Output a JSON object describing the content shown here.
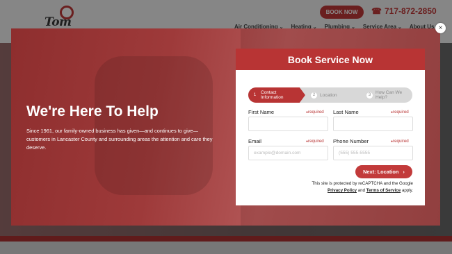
{
  "header": {
    "logo_text": "Tom Falk",
    "book_now_label": "BOOK NOW",
    "phone": "717-872-2850",
    "nav": [
      "Air Conditioning",
      "Heating",
      "Plumbing",
      "Service Area",
      "About Us"
    ]
  },
  "hero": {
    "title": "We're Here To Help",
    "text": "Since 1961, our family-owned business has given—and continues to give—customers in Lancaster County and surrounding areas the attention and care they deserve."
  },
  "form": {
    "title": "Book Service Now",
    "steps": [
      {
        "num": "1",
        "label": "Contact Information"
      },
      {
        "num": "2",
        "label": "Location"
      },
      {
        "num": "3",
        "label": "How Can We Help?"
      }
    ],
    "fields": {
      "first_name": {
        "label": "First Name",
        "required": "required",
        "value": ""
      },
      "last_name": {
        "label": "Last Name",
        "required": "required",
        "value": ""
      },
      "email": {
        "label": "Email",
        "required": "required",
        "placeholder": "example@domain.com"
      },
      "phone": {
        "label": "Phone Number",
        "required": "required",
        "placeholder": "(555) 555-5555"
      }
    },
    "next_label": "Next: Location",
    "next_arrow": "›",
    "recaptcha_text": "This site is protected by reCAPTCHA and the Google",
    "privacy_label": "Privacy Policy",
    "and_text": "and",
    "terms_label": "Terms of Service",
    "apply_text": "apply."
  },
  "close_label": "×",
  "colors": {
    "brand_red": "#c23a3a",
    "header_red": "#b83434"
  }
}
